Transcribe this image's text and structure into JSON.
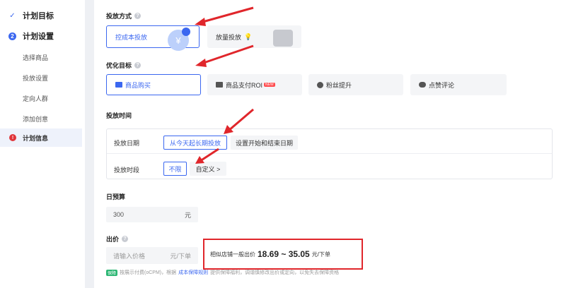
{
  "sidebar": {
    "step1": {
      "icon": "check-icon",
      "label": "计划目标"
    },
    "step2": {
      "number": "2",
      "label": "计划设置"
    },
    "sub_items": [
      "选择商品",
      "投放设置",
      "定向人群",
      "添加创意"
    ],
    "active": {
      "icon": "alert-icon",
      "label": "计划信息"
    }
  },
  "delivery": {
    "title": "投放方式",
    "option_cost": "控成本投放",
    "option_volume": "放量投放"
  },
  "optimize": {
    "title": "优化目标",
    "opt_purchase": "商品购买",
    "opt_roi": "商品支付ROI",
    "new_badge": "NEW",
    "opt_fans": "粉丝提升",
    "opt_like": "点赞评论"
  },
  "schedule": {
    "title": "投放时间",
    "date_label": "投放日期",
    "date_long": "从今天起长期投放",
    "date_range": "设置开始和结束日期",
    "slot_label": "投放时段",
    "slot_any": "不限",
    "slot_custom": "自定义 >"
  },
  "budget": {
    "title": "日预算",
    "value": "300",
    "unit": "元"
  },
  "bid": {
    "title": "出价",
    "placeholder": "请输入价格",
    "unit": "元/下单",
    "hint_prefix": "相似店铺一般出价",
    "hint_range": "18.69 ~ 35.05",
    "hint_unit": "元/下单"
  },
  "footer": {
    "tag": "保障",
    "text1": "按展示付费(oCPM)，根据",
    "link": "成本保障规则",
    "text2": "提供保障福利，调谐慎修改出价或定向，以免失去保障资格"
  },
  "colors": {
    "accent": "#3b67f0",
    "arrow": "#e0262b",
    "highlight_box": "#e0262b"
  }
}
